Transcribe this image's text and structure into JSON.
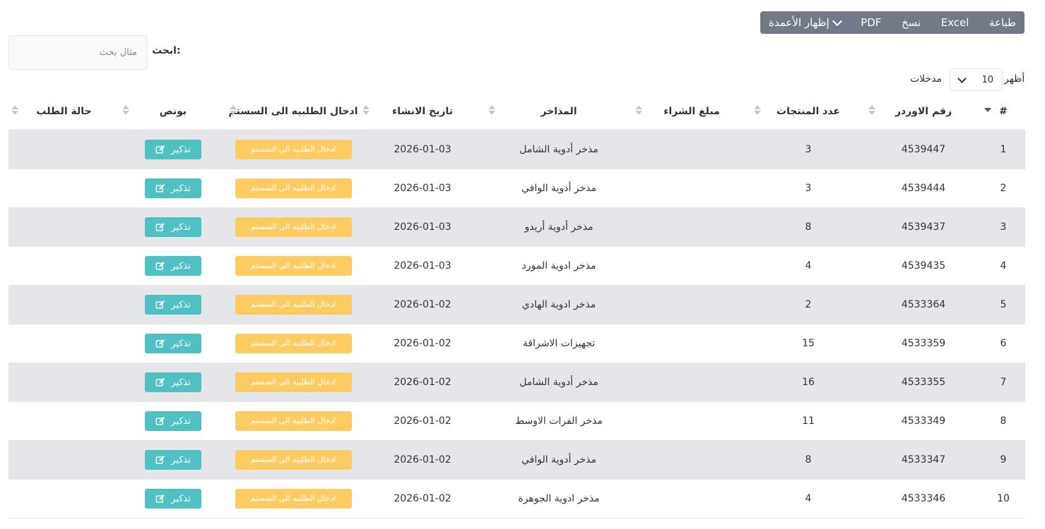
{
  "toolbar": {
    "print": "طباعة",
    "excel": "Excel",
    "copy": "نسخ",
    "pdf": "PDF",
    "columns": "إظهار الأعمدة"
  },
  "search": {
    "label": "ابحث:",
    "placeholder": "مثال بحث"
  },
  "length": {
    "show_label": "أظهر",
    "value": "10",
    "entries_label": "مدخلات"
  },
  "table": {
    "headers": [
      "#",
      "رقم الاوردر",
      "عدد المنتجات",
      "مبلغ الشراء",
      "المذاخر",
      "تاريخ الانشاء",
      "ادخال الطلبيه الى السستم",
      "بونص",
      "حالة الطلب"
    ],
    "enter_button": "ادخال الطلبيه الى السستم",
    "remind_button": "تذكير",
    "rows": [
      {
        "n": "1",
        "order": "4539447",
        "count": "3",
        "amount": "",
        "store": "مذخر أدوية الشامل",
        "date": "2026-01-03",
        "status": ""
      },
      {
        "n": "2",
        "order": "4539444",
        "count": "3",
        "amount": "",
        "store": "مذخر أدوية الوافي",
        "date": "2026-01-03",
        "status": ""
      },
      {
        "n": "3",
        "order": "4539437",
        "count": "8",
        "amount": "",
        "store": "مذخر أدوية أريدو",
        "date": "2026-01-03",
        "status": ""
      },
      {
        "n": "4",
        "order": "4539435",
        "count": "4",
        "amount": "",
        "store": "مذخر ادوية المورد",
        "date": "2026-01-03",
        "status": ""
      },
      {
        "n": "5",
        "order": "4533364",
        "count": "2",
        "amount": "",
        "store": "مذخر ادوية الهادي",
        "date": "2026-01-02",
        "status": ""
      },
      {
        "n": "6",
        "order": "4533359",
        "count": "15",
        "amount": "",
        "store": "تجهيزات الاشراقة",
        "date": "2026-01-02",
        "status": ""
      },
      {
        "n": "7",
        "order": "4533355",
        "count": "16",
        "amount": "",
        "store": "مذخر أدوية الشامل",
        "date": "2026-01-02",
        "status": ""
      },
      {
        "n": "8",
        "order": "4533349",
        "count": "11",
        "amount": "",
        "store": "مذخر الفرات الاوسط",
        "date": "2026-01-02",
        "status": ""
      },
      {
        "n": "9",
        "order": "4533347",
        "count": "8",
        "amount": "",
        "store": "مذخر أدوية الوافي",
        "date": "2026-01-02",
        "status": ""
      },
      {
        "n": "10",
        "order": "4533346",
        "count": "4",
        "amount": "",
        "store": "مذخر ادوية الجوهرة",
        "date": "2026-01-02",
        "status": ""
      }
    ]
  },
  "colors": {
    "toolbar_bg": "#737987",
    "enter_button": "#fdcb62",
    "remind_button": "#4fc1c2",
    "stripe": "#e4e6ea"
  }
}
